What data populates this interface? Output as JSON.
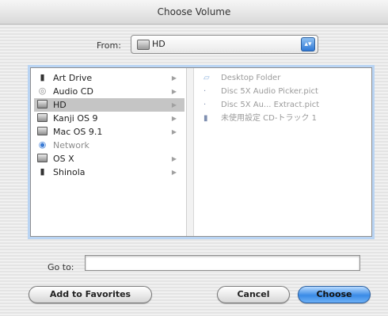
{
  "window": {
    "title": "Choose Volume"
  },
  "from": {
    "label": "From:",
    "value": "HD",
    "arrows": "▴▾"
  },
  "volumes": [
    {
      "label": "Art Drive",
      "icon": "document-icon",
      "glyph": "▮",
      "arrow": "▶"
    },
    {
      "label": "Audio CD",
      "icon": "cd-icon",
      "glyph": "◎",
      "arrow": "▶"
    },
    {
      "label": "HD",
      "icon": "hard-drive-icon",
      "glyph": "",
      "arrow": "▶",
      "selected": true
    },
    {
      "label": "Kanji OS 9",
      "icon": "hard-drive-icon",
      "glyph": "",
      "arrow": "▶"
    },
    {
      "label": "Mac OS 9.1",
      "icon": "hard-drive-icon",
      "glyph": "",
      "arrow": "▶"
    },
    {
      "label": "Network",
      "icon": "network-icon",
      "glyph": "◉",
      "arrow": "",
      "dim": true
    },
    {
      "label": "OS X",
      "icon": "hard-drive-icon",
      "glyph": "",
      "arrow": "▶"
    },
    {
      "label": "Shinola",
      "icon": "document-icon",
      "glyph": "▮",
      "arrow": "▶"
    }
  ],
  "files": [
    {
      "label": "Desktop Folder",
      "icon": "folder-icon",
      "glyph": "▱"
    },
    {
      "label": "Disc 5X Audio Picker.pict",
      "icon": "file-icon",
      "glyph": "·"
    },
    {
      "label": "Disc 5X Au... Extract.pict",
      "icon": "file-icon",
      "glyph": "·"
    },
    {
      "label": "未使用設定 CD-トラック 1",
      "icon": "document-icon",
      "glyph": "▮"
    }
  ],
  "goto": {
    "label": "Go to:",
    "value": ""
  },
  "buttons": {
    "favorites": "Add to Favorites",
    "cancel": "Cancel",
    "choose": "Choose"
  }
}
